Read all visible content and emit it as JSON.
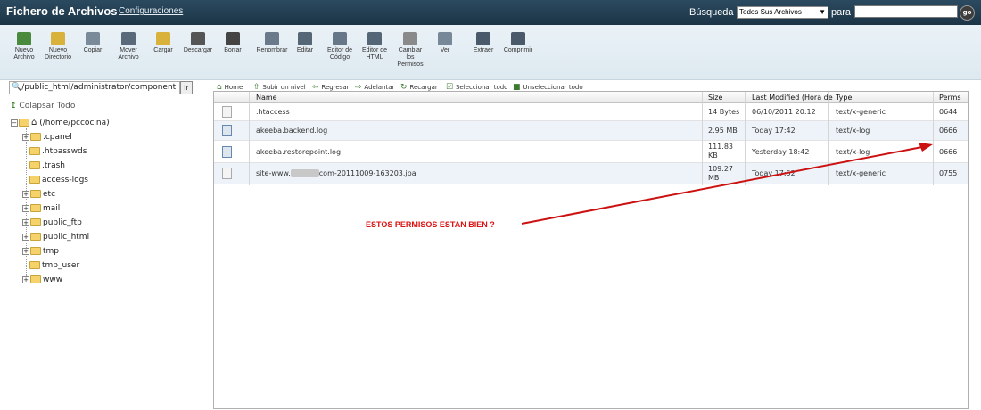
{
  "header": {
    "title": "Fichero de Archivos",
    "config_link": "Configuraciones",
    "search_label": "Búsqueda",
    "search_scope": "Todos Sus Archivos",
    "para_label": "para",
    "search_value": "",
    "go_label": "go"
  },
  "toolbar": [
    {
      "label": "Nuevo Archivo",
      "icon": "new-file-icon"
    },
    {
      "label": "Nuevo Directorio",
      "icon": "new-folder-icon"
    },
    {
      "label": "Copiar",
      "icon": "copy-icon"
    },
    {
      "label": "Mover Archivo",
      "icon": "move-icon"
    },
    {
      "label": "Cargar",
      "icon": "upload-icon"
    },
    {
      "label": "Descargar",
      "icon": "download-icon"
    },
    {
      "label": "Borrar",
      "icon": "delete-icon"
    },
    {
      "label": "Renombrar",
      "icon": "rename-icon"
    },
    {
      "label": "Editar",
      "icon": "edit-icon"
    },
    {
      "label": "Editor de Código",
      "icon": "code-editor-icon"
    },
    {
      "label": "Editor de HTML",
      "icon": "html-editor-icon"
    },
    {
      "label": "Cambiar los Permisos",
      "icon": "permissions-icon"
    },
    {
      "label": "Ver",
      "icon": "view-icon"
    },
    {
      "label": "Extraer",
      "icon": "extract-icon"
    },
    {
      "label": "Comprimir",
      "icon": "compress-icon"
    }
  ],
  "sidebar": {
    "path_value": "/public_html/administrator/component",
    "go_label": "Ir",
    "collapse_label": "Colapsar Todo",
    "root_label": "(/home/pccocina)",
    "tree": [
      {
        "label": ".cpanel",
        "expandable": true
      },
      {
        "label": ".htpasswds",
        "expandable": false
      },
      {
        "label": ".trash",
        "expandable": false
      },
      {
        "label": "access-logs",
        "expandable": false
      },
      {
        "label": "etc",
        "expandable": true
      },
      {
        "label": "mail",
        "expandable": true
      },
      {
        "label": "public_ftp",
        "expandable": true
      },
      {
        "label": "public_html",
        "expandable": true
      },
      {
        "label": "tmp",
        "expandable": true
      },
      {
        "label": "tmp_user",
        "expandable": false
      },
      {
        "label": "www",
        "expandable": true
      }
    ]
  },
  "navbar": [
    {
      "label": "Home",
      "icon": "home-icon"
    },
    {
      "label": "Subir un nivel",
      "icon": "up-level-icon"
    },
    {
      "label": "Regresar",
      "icon": "back-icon"
    },
    {
      "label": "Adelantar",
      "icon": "forward-icon"
    },
    {
      "label": "Recargar",
      "icon": "reload-icon"
    },
    {
      "label": "Seleccionar todo",
      "icon": "select-all-icon"
    },
    {
      "label": "Unseleccionar todo",
      "icon": "unselect-all-icon"
    }
  ],
  "table": {
    "columns": [
      "Name",
      "Size",
      "Last Modified (Hora de",
      "Type",
      "Perms"
    ],
    "rows": [
      {
        "name": ".htaccess",
        "size": "14 Bytes",
        "modified": "06/10/2011 20:12",
        "type": "text/x-generic",
        "perms": "0644",
        "kind": "generic"
      },
      {
        "name": "akeeba.backend.log",
        "size": "2.95 MB",
        "modified": "Today 17:42",
        "type": "text/x-log",
        "perms": "0666",
        "kind": "log"
      },
      {
        "name": "akeeba.restorepoint.log",
        "size": "111.83 KB",
        "modified": "Yesterday 18:42",
        "type": "text/x-log",
        "perms": "0666",
        "kind": "log"
      },
      {
        "name_prefix": "site-www.",
        "name_suffix": "com-20111009-163203.jpa",
        "size": "109.27 MB",
        "modified": "Today 17:52",
        "type": "text/x-generic",
        "perms": "0755",
        "kind": "generic"
      }
    ]
  },
  "annotation": {
    "text": "ESTOS PERMISOS ESTAN BIEN ?",
    "color": "#dd1111"
  },
  "colors": {
    "header_bg": "#1f3a4e",
    "toolbar_bg": "#e2ecf2",
    "row_alt": "#edf3f8"
  }
}
